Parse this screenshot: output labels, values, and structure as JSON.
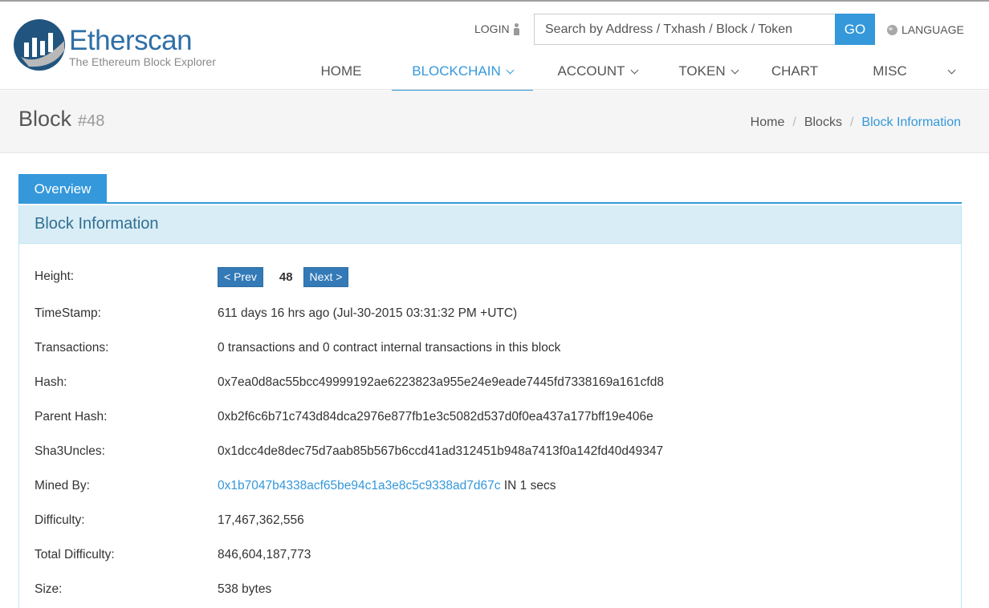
{
  "brand": {
    "name": "Etherscan",
    "tagline": "The Ethereum Block Explorer"
  },
  "header": {
    "login_label": "LOGIN",
    "search_placeholder": "Search by Address / Txhash / Block / Token",
    "search_button": "GO",
    "language_label": "LANGUAGE"
  },
  "nav": {
    "items": [
      {
        "label": "HOME"
      },
      {
        "label": "BLOCKCHAIN"
      },
      {
        "label": "ACCOUNT"
      },
      {
        "label": "TOKEN"
      },
      {
        "label": "CHART"
      },
      {
        "label": "MISC"
      }
    ]
  },
  "page": {
    "title": "Block",
    "block_number": "#48",
    "breadcrumb": [
      "Home",
      "Blocks",
      "Block Information"
    ]
  },
  "tabs": {
    "overview": "Overview"
  },
  "panel": {
    "heading": "Block Information",
    "height": {
      "label": "Height:",
      "prev": "< Prev",
      "value": "48",
      "next": "Next >"
    },
    "timestamp": {
      "label": "TimeStamp:",
      "value": "611 days 16 hrs ago (Jul-30-2015 03:31:32 PM +UTC)"
    },
    "transactions": {
      "label": "Transactions:",
      "value": "0 transactions and 0 contract internal transactions in this block"
    },
    "hash": {
      "label": "Hash:",
      "value": "0x7ea0d8ac55bcc49999192ae6223823a955e24e9eade7445fd7338169a161cfd8"
    },
    "parent_hash": {
      "label": "Parent Hash:",
      "value": "0xb2f6c6b71c743d84dca2976e877fb1e3c5082d537d0f0ea437a177bff19e406e"
    },
    "sha3uncles": {
      "label": "Sha3Uncles:",
      "value": "0x1dcc4de8dec75d7aab85b567b6ccd41ad312451b948a7413f0a142fd40d49347"
    },
    "mined_by": {
      "label": "Mined By:",
      "address": "0x1b7047b4338acf65be94c1a3e8c5c9338ad7d67c",
      "suffix": " IN 1 secs"
    },
    "difficulty": {
      "label": "Difficulty:",
      "value": "17,467,362,556"
    },
    "total_difficulty": {
      "label": "Total Difficulty:",
      "value": "846,604,187,773"
    },
    "size": {
      "label": "Size:",
      "value": "538 bytes"
    }
  },
  "colors": {
    "accent": "#3498db",
    "panel_head_bg": "#d9edf7",
    "panel_head_text": "#31708f"
  }
}
